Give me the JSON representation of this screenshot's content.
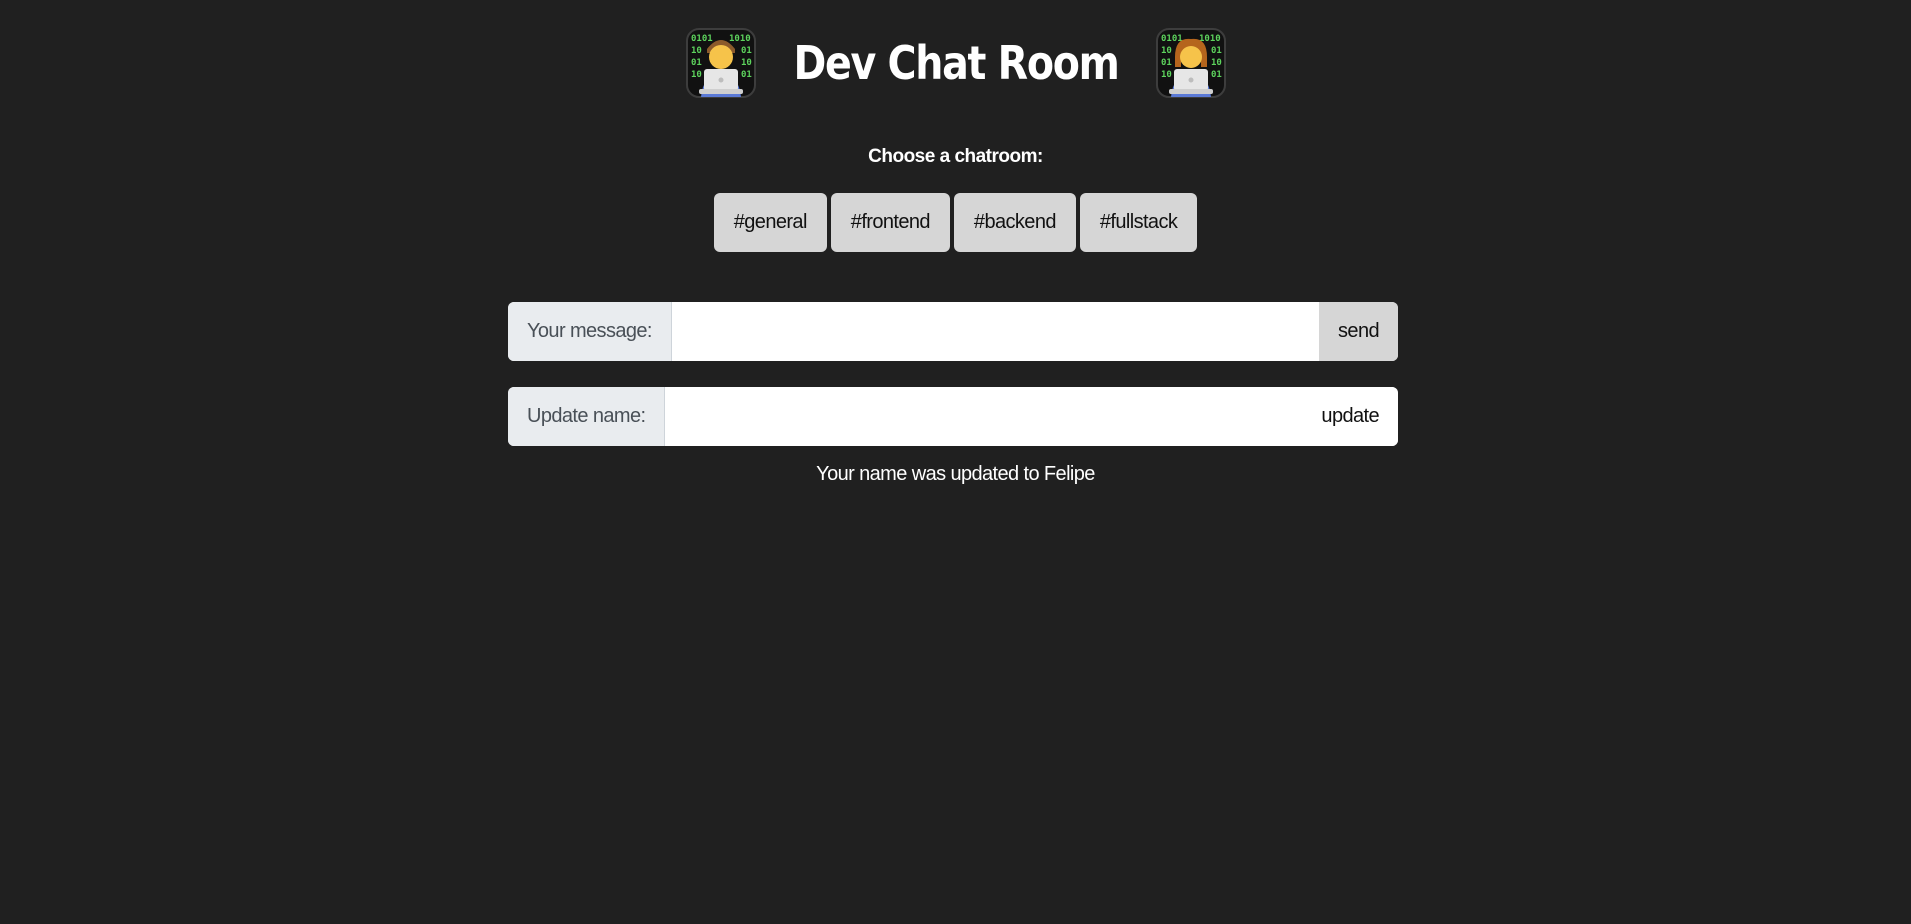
{
  "header": {
    "title": "Dev Chat Room",
    "left_icon": "technologist-emoji-icon",
    "right_icon": "technologist-emoji-icon"
  },
  "chatrooms": {
    "label": "Choose a chatroom:",
    "rooms": [
      "#general",
      "#frontend",
      "#backend",
      "#fullstack"
    ]
  },
  "message_form": {
    "label": "Your message:",
    "value": "",
    "button_label": "send"
  },
  "name_form": {
    "label": "Update name:",
    "value": "",
    "button_label": "update"
  },
  "status": {
    "text": "Your name was updated to Felipe"
  },
  "colors": {
    "background": "#202020",
    "button": "#d6d6d6",
    "input_label_bg": "#e9ecef",
    "text": "#ffffff"
  }
}
